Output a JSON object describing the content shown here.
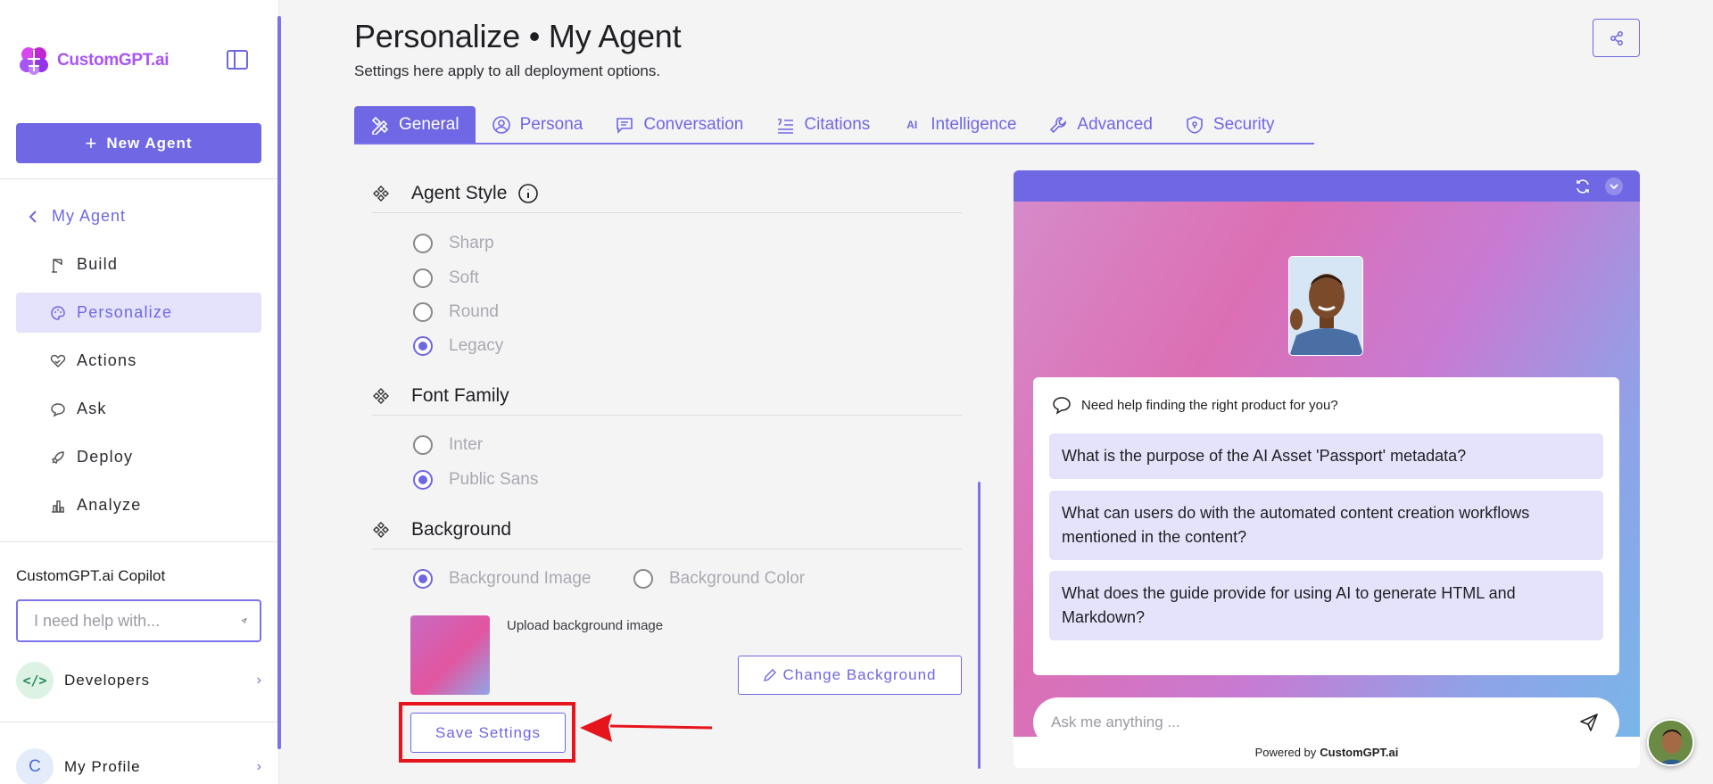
{
  "sidebar": {
    "logo_text": "CustomGPT.ai",
    "new_agent_label": "New Agent",
    "back_label": "My Agent",
    "nav": [
      {
        "label": "Build",
        "icon": "crane-icon"
      },
      {
        "label": "Personalize",
        "icon": "palette-icon",
        "active": true
      },
      {
        "label": "Actions",
        "icon": "heart-handshake-icon"
      },
      {
        "label": "Ask",
        "icon": "chat-bubble-icon"
      },
      {
        "label": "Deploy",
        "icon": "rocket-icon"
      },
      {
        "label": "Analyze",
        "icon": "bar-chart-icon"
      }
    ],
    "copilot_title": "CustomGPT.ai Copilot",
    "copilot_placeholder": "I need help with...",
    "developers_label": "Developers",
    "profile_initial": "C",
    "profile_label": "My Profile"
  },
  "header": {
    "title": "Personalize • My Agent",
    "subtitle": "Settings here apply to all deployment options."
  },
  "tabs": [
    {
      "label": "General",
      "icon": "pencil-ruler-icon",
      "active": true
    },
    {
      "label": "Persona",
      "icon": "user-circle-icon"
    },
    {
      "label": "Conversation",
      "icon": "message-square-icon"
    },
    {
      "label": "Citations",
      "icon": "quote-list-icon"
    },
    {
      "label": "Intelligence",
      "icon": "ai-icon"
    },
    {
      "label": "Advanced",
      "icon": "wrench-icon"
    },
    {
      "label": "Security",
      "icon": "shield-icon"
    }
  ],
  "agent_style": {
    "title": "Agent Style",
    "options": [
      "Sharp",
      "Soft",
      "Round",
      "Legacy"
    ],
    "selected": "Legacy"
  },
  "font_family": {
    "title": "Font Family",
    "options": [
      "Inter",
      "Public Sans"
    ],
    "selected": "Public Sans"
  },
  "background": {
    "title": "Background",
    "options": [
      "Background Image",
      "Background Color"
    ],
    "selected": "Background Image",
    "upload_label": "Upload background image",
    "change_button": "Change Background"
  },
  "save_button": "Save Settings",
  "preview": {
    "intro": "Need help finding the right product for you?",
    "suggestions": [
      "What is the purpose of the AI Asset 'Passport' metadata?",
      "What can users do with the automated content creation workflows mentioned in the content?",
      "What does the guide provide for using AI to generate HTML and Markdown?"
    ],
    "ask_placeholder": "Ask me anything ...",
    "powered_by": "Powered by",
    "powered_brand": "CustomGPT.ai"
  },
  "colors": {
    "accent": "#6f67e3",
    "highlight": "#e6141b"
  }
}
